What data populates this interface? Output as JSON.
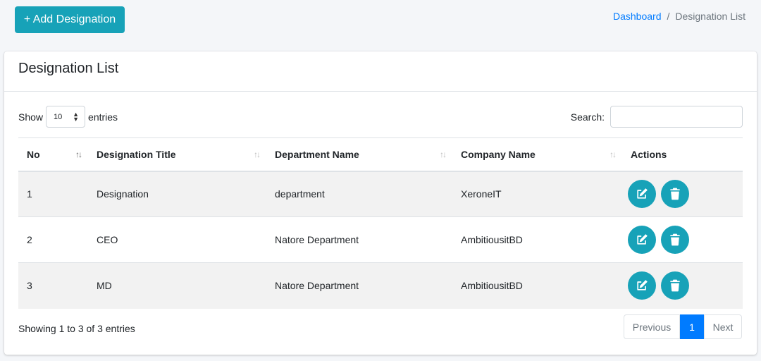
{
  "header": {
    "add_button_label": "+ Add Designation",
    "breadcrumb": {
      "home": "Dashboard",
      "separator": "/",
      "current": "Designation List"
    }
  },
  "card": {
    "title": "Designation List",
    "show_label": "Show",
    "entries_value": "10",
    "entries_label": "entries",
    "search_label": "Search:",
    "search_value": ""
  },
  "table": {
    "columns": [
      "No",
      "Designation Title",
      "Department Name",
      "Company Name",
      "Actions"
    ],
    "rows": [
      {
        "no": "1",
        "title": "Designation",
        "department": "department",
        "company": "XeroneIT"
      },
      {
        "no": "2",
        "title": "CEO",
        "department": "Natore Department",
        "company": "AmbitiousitBD"
      },
      {
        "no": "3",
        "title": "MD",
        "department": "Natore Department",
        "company": "AmbitiousitBD"
      }
    ],
    "action_icons": [
      "edit-icon",
      "trash-icon"
    ]
  },
  "footer": {
    "info": "Showing 1 to 3 of 3 entries",
    "previous": "Previous",
    "page": "1",
    "next": "Next"
  },
  "colors": {
    "accent": "#17a2b8",
    "link": "#007bff",
    "background": "#f4f6f9"
  }
}
